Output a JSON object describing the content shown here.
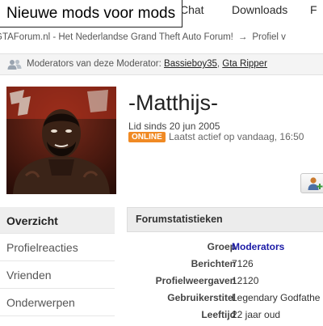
{
  "page": {
    "title_box": "Nieuwe mods voor mods"
  },
  "nav": {
    "items": [
      {
        "label": "Chat"
      },
      {
        "label": "Downloads"
      },
      {
        "label": "F"
      }
    ]
  },
  "breadcrumb": {
    "forum": "GTAForum.nl - Het Nederlandse Grand Theft Auto Forum!",
    "separator": "→",
    "current": "Profiel v"
  },
  "moderators_bar": {
    "icon": "people-icon",
    "label": "Moderators van deze Moderator:",
    "moderators": [
      "Bassieboy35",
      "Gta Ripper"
    ],
    "separator": ", "
  },
  "profile": {
    "username": "-Matthijs-",
    "since": "Lid sinds 20 jun 2005",
    "status_badge": "ONLINE",
    "last_active": "Laatst actief op vandaag, 16:50",
    "avatar": "user-avatar-photo",
    "action_icon": "add-friend-icon"
  },
  "sidebar": {
    "items": [
      {
        "label": "Overzicht",
        "active": true
      },
      {
        "label": "Profielreacties"
      },
      {
        "label": "Vrienden"
      },
      {
        "label": "Onderwerpen"
      }
    ]
  },
  "stats": {
    "header": "Forumstatistieken",
    "rows": [
      {
        "label": "Groep",
        "value": "Moderators"
      },
      {
        "label": "Berichten",
        "value": "7126"
      },
      {
        "label": "Profielweergaven",
        "value": "12120"
      },
      {
        "label": "Gebruikerstitel",
        "value": "Legendary Godfathe"
      },
      {
        "label": "Leeftijd",
        "value": "22 jaar oud"
      }
    ]
  },
  "colors": {
    "badge": "#f08a24",
    "link": "#1a1aa6"
  }
}
